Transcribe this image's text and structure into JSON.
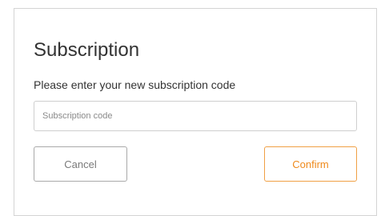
{
  "dialog": {
    "title": "Subscription",
    "prompt": "Please enter your new subscription code",
    "input": {
      "placeholder": "Subscription code",
      "value": ""
    },
    "buttons": {
      "cancel_label": "Cancel",
      "confirm_label": "Confirm"
    }
  },
  "colors": {
    "accent": "#ef8a1c",
    "cancel_border": "#a9a9a9",
    "dialog_border": "#d4d4d4"
  }
}
